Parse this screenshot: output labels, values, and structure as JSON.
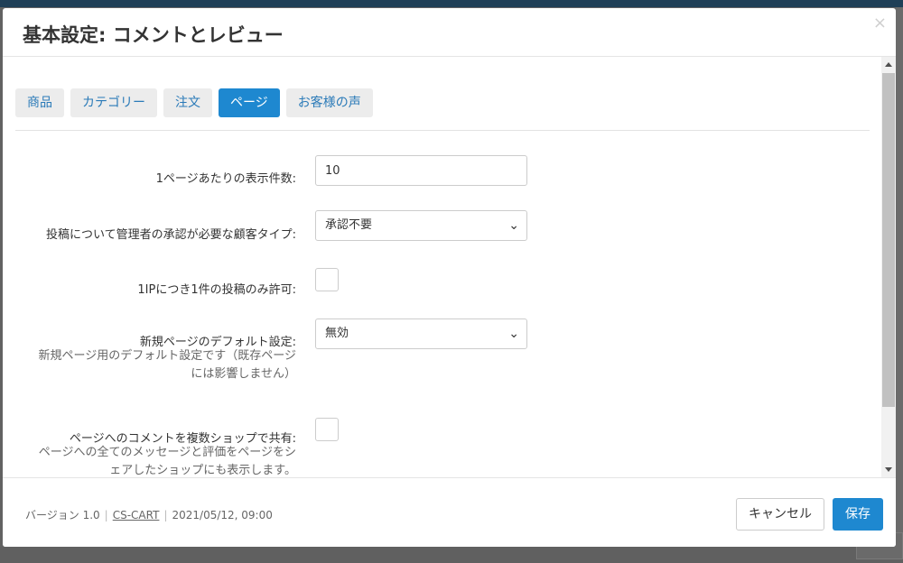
{
  "modal": {
    "title": "基本設定: コメントとレビュー",
    "close_symbol": "×"
  },
  "tabs": [
    {
      "label": "商品",
      "active": false
    },
    {
      "label": "カテゴリー",
      "active": false
    },
    {
      "label": "注文",
      "active": false
    },
    {
      "label": "ページ",
      "active": true
    },
    {
      "label": "お客様の声",
      "active": false
    }
  ],
  "fields": {
    "per_page": {
      "label": "1ページあたりの表示件数:",
      "value": "10"
    },
    "approval": {
      "label": "投稿について管理者の承認が必要な顧客タイプ:",
      "selected": "承認不要"
    },
    "one_per_ip": {
      "label": "1IPにつき1件の投稿のみ許可:",
      "checked": false
    },
    "new_page_default": {
      "label": "新規ページのデフォルト設定:",
      "selected": "無効",
      "description_line1": "新規ページ用のデフォルト設定です（既存ページ",
      "description_line2": "には影響しません）"
    },
    "share_comments": {
      "label": "ページへのコメントを複数ショップで共有:",
      "checked": false,
      "description_line1": "ページへの全てのメッセージと評価をページをシ",
      "description_line2": "ェアしたショップにも表示します。"
    }
  },
  "footer": {
    "version": "バージョン 1.0",
    "vendor_link": "CS-CART",
    "date": "2021/05/12, 09:00",
    "cancel_label": "キャンセル",
    "save_label": "保存"
  },
  "colors": {
    "accent": "#1e88d0",
    "tab_bg": "#ececec",
    "overlay": "#626262"
  }
}
